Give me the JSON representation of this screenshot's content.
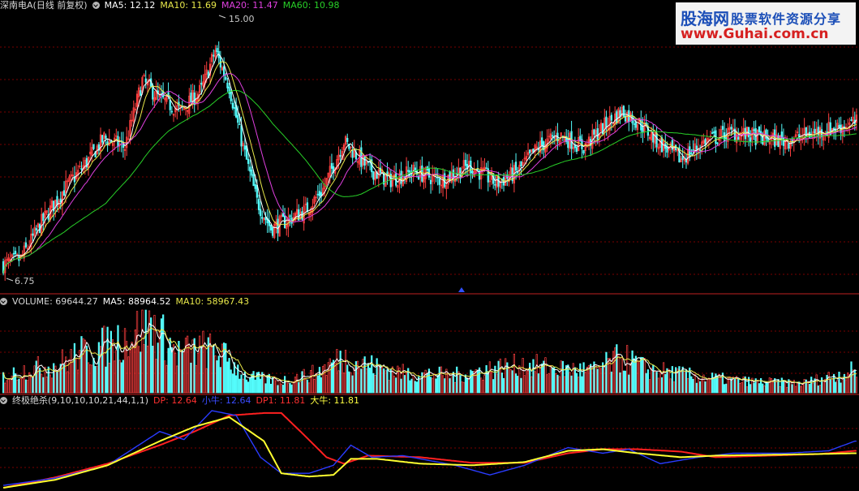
{
  "header": {
    "main": {
      "title": "深南电A(日线 前复权)",
      "items": [
        {
          "label": "MA5: 12.12",
          "color": "#ffffff"
        },
        {
          "label": "MA10: 11.69",
          "color": "#e8e84a"
        },
        {
          "label": "MA20: 11.47",
          "color": "#e040e0"
        },
        {
          "label": "MA60: 10.98",
          "color": "#28d028"
        }
      ]
    },
    "volume": {
      "items": [
        {
          "label": "VOLUME: 69644.27",
          "color": "#d8d8d8"
        },
        {
          "label": "MA5: 88964.52",
          "color": "#ffffff"
        },
        {
          "label": "MA10: 58967.43",
          "color": "#e8e84a"
        }
      ]
    },
    "indicator": {
      "items": [
        {
          "label": "终极绝杀(9,10,10,10,21,44,1,1)",
          "color": "#d8d8d8"
        },
        {
          "label": "DP: 12.64",
          "color": "#ff3030"
        },
        {
          "label": "小牛: 12.64",
          "color": "#3a4cff"
        },
        {
          "label": "DP1: 11.81",
          "color": "#ff3030"
        },
        {
          "label": "大牛: 11.81",
          "color": "#ffff40"
        }
      ]
    }
  },
  "watermark": {
    "logo": "股海网",
    "slogan": "股票软件资源分享",
    "url": "www.Guhai.com.cn"
  },
  "chart_data": {
    "type": "candlestick",
    "price_high_label": "15.00",
    "price_low_label": "6.75",
    "price_ylim": [
      6.3,
      15.5
    ],
    "colors": {
      "up": "#ff4040",
      "down": "#54fcfc",
      "ma5": "#ffffff",
      "ma10": "#e8e84a",
      "ma20": "#e040e0",
      "ma60": "#28d028",
      "dp": "#ff2020",
      "small_bull": "#2a3cff",
      "big_bull": "#ffff30"
    },
    "close_keypoints": [
      [
        0,
        7.1
      ],
      [
        10,
        7.3
      ],
      [
        22,
        8.5
      ],
      [
        35,
        9.6
      ],
      [
        48,
        10.5
      ],
      [
        58,
        11.3
      ],
      [
        70,
        11.0
      ],
      [
        80,
        13.2
      ],
      [
        90,
        12.6
      ],
      [
        102,
        12.2
      ],
      [
        114,
        12.9
      ],
      [
        122,
        14.2
      ],
      [
        130,
        13.0
      ],
      [
        138,
        11.0
      ],
      [
        146,
        9.2
      ],
      [
        154,
        8.3
      ],
      [
        164,
        8.6
      ],
      [
        174,
        8.9
      ],
      [
        184,
        9.6
      ],
      [
        196,
        11.2
      ],
      [
        210,
        10.3
      ],
      [
        222,
        9.9
      ],
      [
        236,
        10.2
      ],
      [
        252,
        9.9
      ],
      [
        268,
        10.4
      ],
      [
        284,
        9.8
      ],
      [
        296,
        10.2
      ],
      [
        308,
        11.0
      ],
      [
        320,
        11.4
      ],
      [
        334,
        11.0
      ],
      [
        346,
        11.7
      ],
      [
        356,
        12.2
      ],
      [
        366,
        11.8
      ],
      [
        376,
        11.2
      ],
      [
        390,
        10.6
      ],
      [
        404,
        11.2
      ],
      [
        420,
        11.5
      ],
      [
        436,
        11.3
      ],
      [
        450,
        11.2
      ],
      [
        468,
        11.5
      ],
      [
        490,
        11.8
      ]
    ],
    "volume_keypoints": [
      [
        0,
        0.2
      ],
      [
        15,
        0.3
      ],
      [
        30,
        0.35
      ],
      [
        45,
        0.5
      ],
      [
        60,
        0.6
      ],
      [
        75,
        0.75
      ],
      [
        85,
        0.85
      ],
      [
        100,
        0.5
      ],
      [
        115,
        0.55
      ],
      [
        125,
        0.5
      ],
      [
        140,
        0.2
      ],
      [
        160,
        0.15
      ],
      [
        180,
        0.25
      ],
      [
        195,
        0.45
      ],
      [
        210,
        0.35
      ],
      [
        230,
        0.25
      ],
      [
        260,
        0.22
      ],
      [
        280,
        0.3
      ],
      [
        300,
        0.35
      ],
      [
        320,
        0.3
      ],
      [
        340,
        0.28
      ],
      [
        356,
        0.45
      ],
      [
        370,
        0.3
      ],
      [
        400,
        0.2
      ],
      [
        430,
        0.14
      ],
      [
        460,
        0.12
      ],
      [
        490,
        0.28
      ]
    ],
    "dp_keypoints": [
      [
        0,
        0.02
      ],
      [
        30,
        0.15
      ],
      [
        60,
        0.32
      ],
      [
        90,
        0.55
      ],
      [
        110,
        0.72
      ],
      [
        130,
        0.92
      ],
      [
        150,
        0.95
      ],
      [
        160,
        0.95
      ],
      [
        172,
        0.7
      ],
      [
        186,
        0.4
      ],
      [
        196,
        0.32
      ],
      [
        210,
        0.42
      ],
      [
        240,
        0.4
      ],
      [
        270,
        0.33
      ],
      [
        300,
        0.33
      ],
      [
        325,
        0.45
      ],
      [
        345,
        0.5
      ],
      [
        365,
        0.5
      ],
      [
        390,
        0.47
      ],
      [
        410,
        0.4
      ],
      [
        440,
        0.42
      ],
      [
        470,
        0.44
      ],
      [
        490,
        0.48
      ]
    ],
    "small_bull_keypoints": [
      [
        0,
        0.05
      ],
      [
        30,
        0.14
      ],
      [
        60,
        0.3
      ],
      [
        90,
        0.72
      ],
      [
        104,
        0.62
      ],
      [
        120,
        0.98
      ],
      [
        134,
        0.92
      ],
      [
        148,
        0.4
      ],
      [
        160,
        0.2
      ],
      [
        176,
        0.2
      ],
      [
        190,
        0.3
      ],
      [
        200,
        0.55
      ],
      [
        212,
        0.4
      ],
      [
        230,
        0.42
      ],
      [
        260,
        0.3
      ],
      [
        280,
        0.18
      ],
      [
        300,
        0.3
      ],
      [
        325,
        0.52
      ],
      [
        345,
        0.45
      ],
      [
        360,
        0.5
      ],
      [
        378,
        0.32
      ],
      [
        400,
        0.4
      ],
      [
        420,
        0.45
      ],
      [
        450,
        0.45
      ],
      [
        475,
        0.48
      ],
      [
        490,
        0.6
      ]
    ],
    "big_bull_keypoints": [
      [
        0,
        0.02
      ],
      [
        30,
        0.12
      ],
      [
        60,
        0.3
      ],
      [
        90,
        0.6
      ],
      [
        110,
        0.78
      ],
      [
        130,
        0.9
      ],
      [
        150,
        0.6
      ],
      [
        160,
        0.2
      ],
      [
        176,
        0.16
      ],
      [
        190,
        0.18
      ],
      [
        200,
        0.38
      ],
      [
        215,
        0.38
      ],
      [
        240,
        0.32
      ],
      [
        270,
        0.3
      ],
      [
        300,
        0.34
      ],
      [
        325,
        0.48
      ],
      [
        345,
        0.5
      ],
      [
        365,
        0.45
      ],
      [
        390,
        0.4
      ],
      [
        410,
        0.42
      ],
      [
        440,
        0.43
      ],
      [
        470,
        0.44
      ],
      [
        490,
        0.45
      ]
    ]
  }
}
